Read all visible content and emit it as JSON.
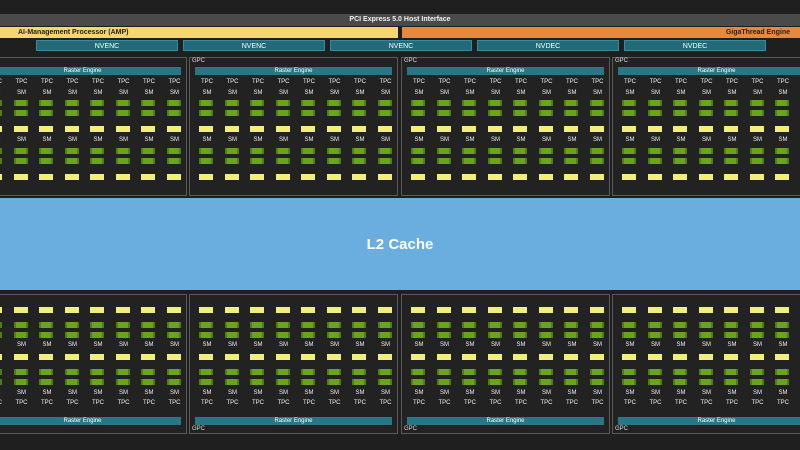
{
  "header": {
    "host_interface": "PCI Express 5.0 Host Interface",
    "amp": "AI-Management Processor (AMP)",
    "gigathread": "GigaThread Engine"
  },
  "codecs": [
    "NVENC",
    "NVENC",
    "NVENC",
    "NVDEC",
    "NVDEC"
  ],
  "l2_cache": "L2 Cache",
  "gpc": {
    "label": "GPC",
    "raster_engine": "Raster Engine",
    "tpc_label": "TPC",
    "sm_label": "SM"
  },
  "colors": {
    "sm_green": "#6aa31e",
    "l1_yellow": "#f1ef7a",
    "l2_blue": "#6aaee0",
    "raster_teal": "#2a7686",
    "amp_yellow": "#f5d76e",
    "gigathread_orange": "#e8893a"
  }
}
